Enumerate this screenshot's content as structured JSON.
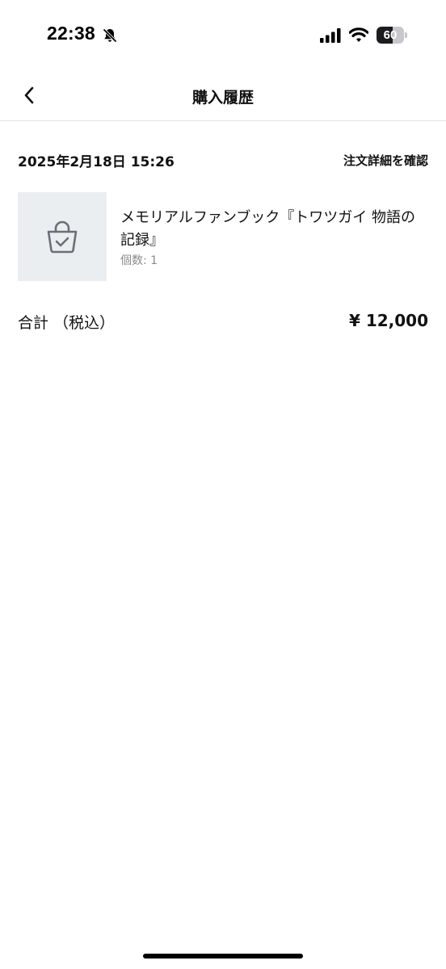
{
  "status_bar": {
    "time": "22:38",
    "battery_level": "60",
    "battery_fraction": 0.6,
    "icons": [
      "bell-slash-icon",
      "cellular-signal-icon",
      "wifi-icon",
      "battery-icon"
    ]
  },
  "nav": {
    "title": "購入履歴",
    "back_icon": "chevron-left-icon"
  },
  "order": {
    "date": "2025年2月18日 15:26",
    "detail_link": "注文詳細を確認",
    "item": {
      "thumbnail_icon": "shopping-bag-check-icon",
      "name": "メモリアルファンブック『トワツガイ 物語の記録』",
      "quantity": "個数: 1"
    },
    "total_label": "合計 （税込）",
    "total_value": "¥ 12,000"
  },
  "colors": {
    "background": "#ffffff",
    "text": "#111111",
    "muted_text": "#8a8a8a",
    "thumbnail_bg": "#ebeef1",
    "icon_gray": "#6b6f77",
    "divider": "#e3e3e3"
  }
}
